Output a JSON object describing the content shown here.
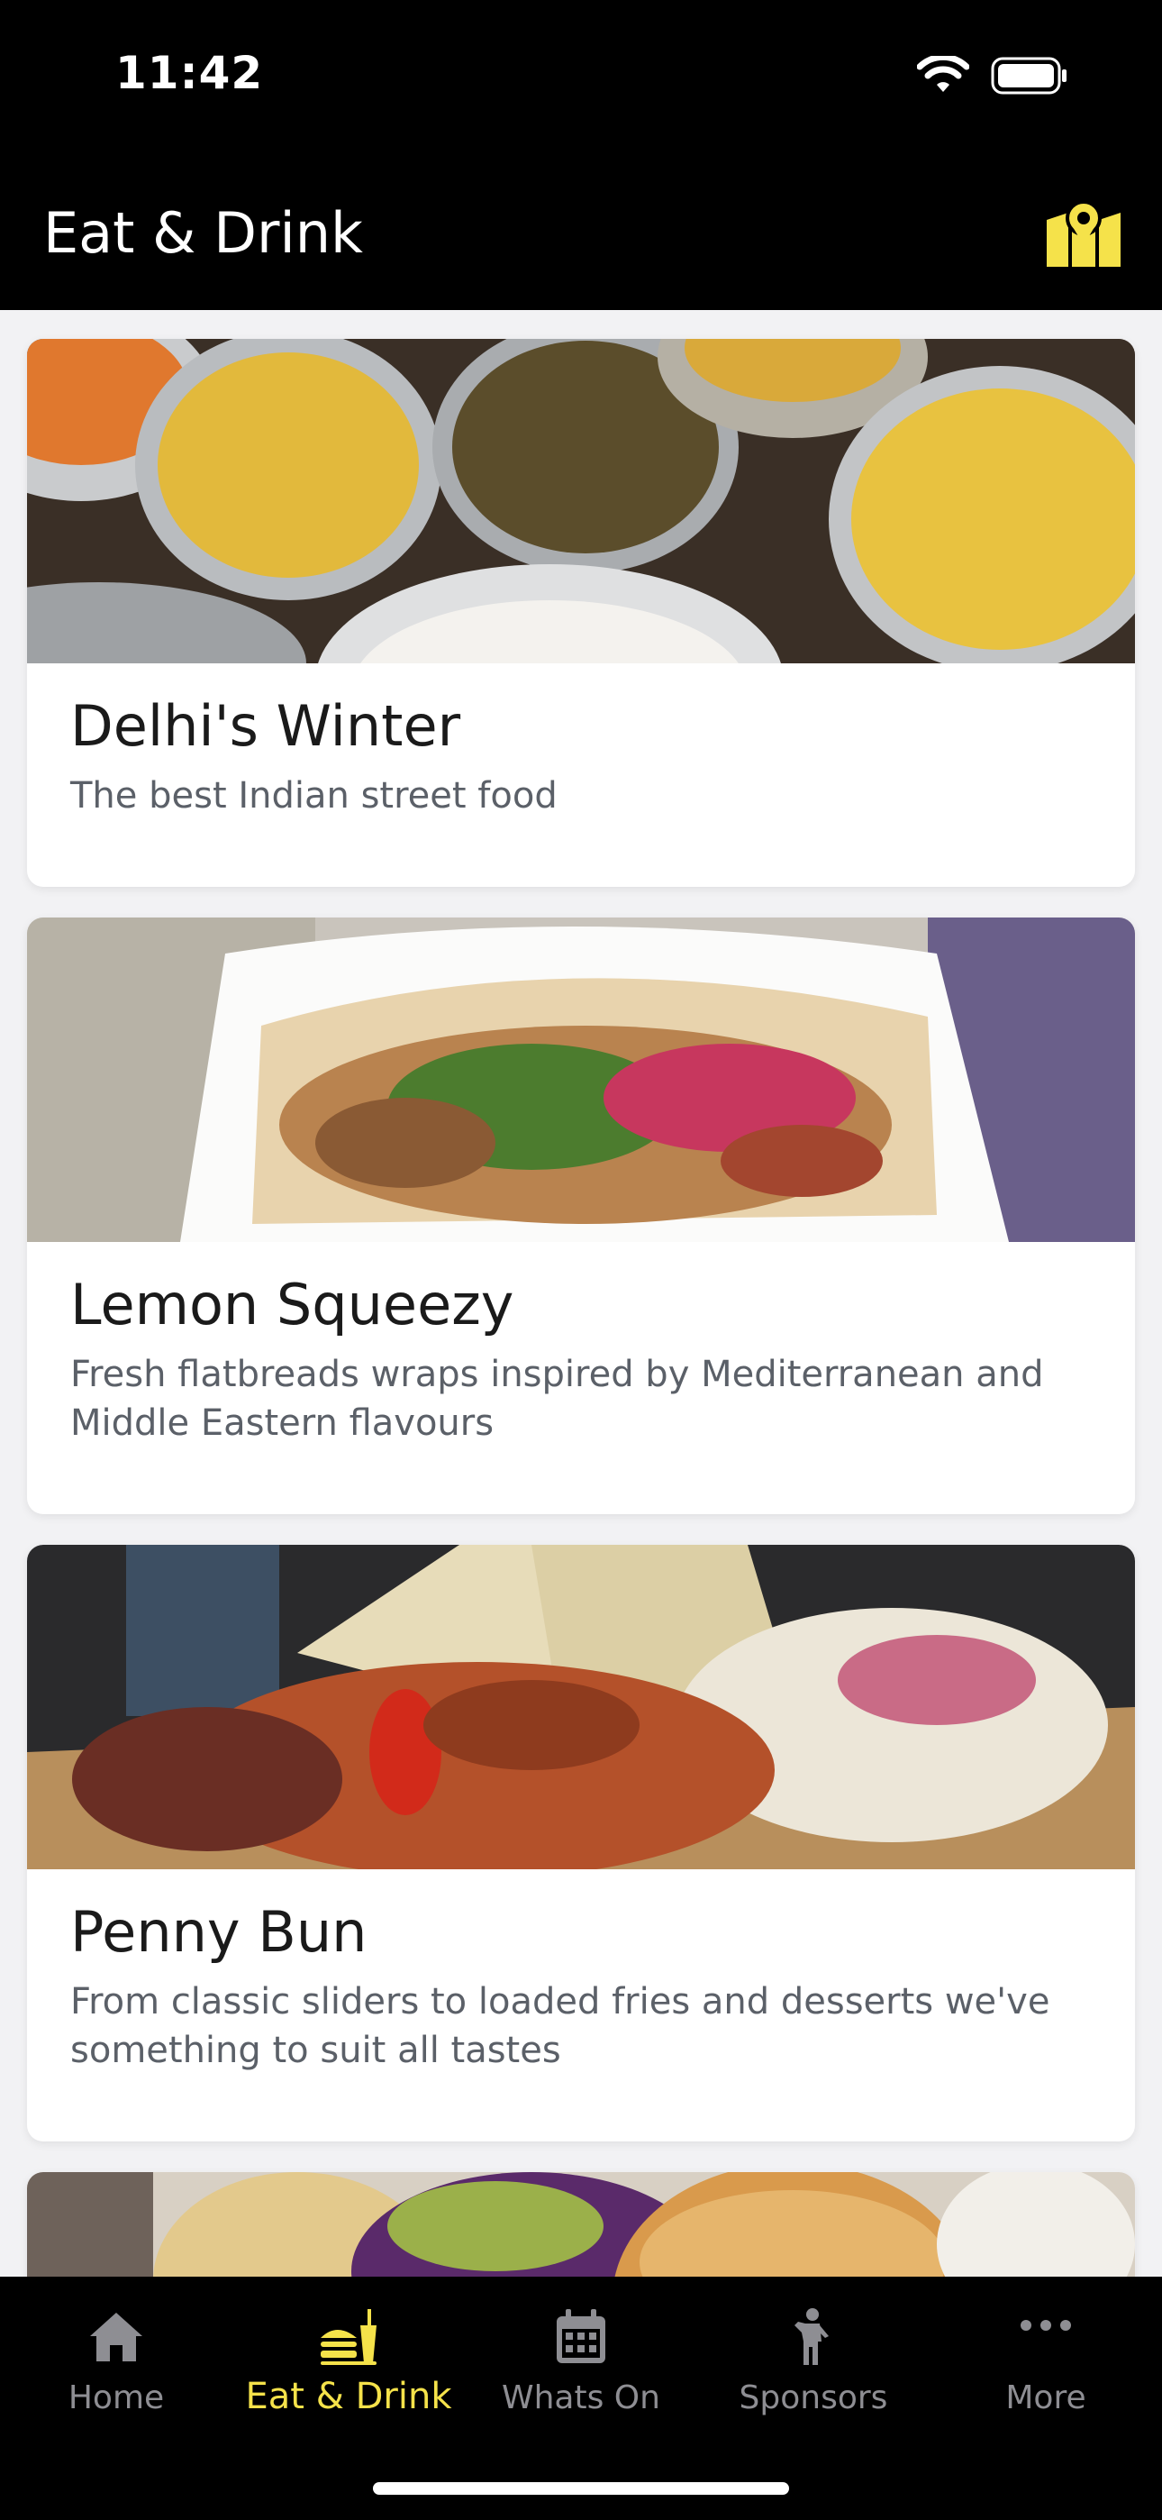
{
  "status_bar": {
    "time": "11:42"
  },
  "header": {
    "title": "Eat & Drink",
    "map_icon": "map-icon"
  },
  "colors": {
    "accent": "#f5e24a",
    "inactive_tab": "#8e8e93",
    "bar_bg": "#000000",
    "page_bg": "#f2f2f4"
  },
  "cards": [
    {
      "title": "Delhi's Winter",
      "description": "The best Indian street food"
    },
    {
      "title": "Lemon Squeezy",
      "description": "Fresh flatbreads wraps inspired by Mediterranean and Middle Eastern flavours"
    },
    {
      "title": "Penny Bun",
      "description": "From classic sliders to loaded fries and desserts we've something to suit all tastes"
    }
  ],
  "tabs": [
    {
      "label": "Home",
      "icon": "home-icon",
      "active": false
    },
    {
      "label": "Eat & Drink",
      "icon": "burger-drink-icon",
      "active": true
    },
    {
      "label": "Whats On",
      "icon": "calendar-icon",
      "active": false
    },
    {
      "label": "Sponsors",
      "icon": "person-icon",
      "active": false
    },
    {
      "label": "More",
      "icon": "more-dots-icon",
      "active": false
    }
  ]
}
